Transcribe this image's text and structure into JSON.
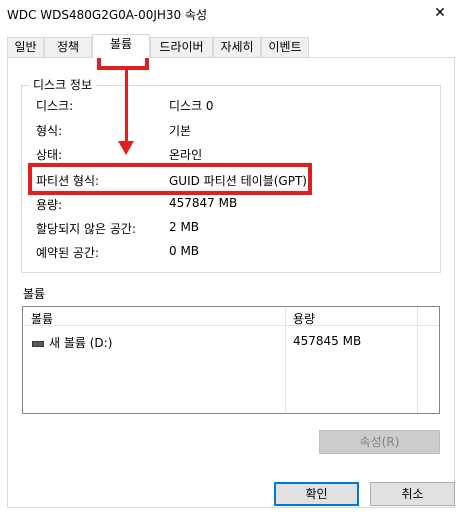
{
  "window": {
    "title": "WDC WDS480G2G0A-00JH30 속성",
    "close_glyph": "✕"
  },
  "tabs": [
    {
      "label": "일반",
      "active": false
    },
    {
      "label": "정책",
      "active": false
    },
    {
      "label": "볼륨",
      "active": true
    },
    {
      "label": "드라이버",
      "active": false
    },
    {
      "label": "자세히",
      "active": false
    },
    {
      "label": "이벤트",
      "active": false
    }
  ],
  "disk_info": {
    "title": "디스크 정보",
    "rows": [
      {
        "label": "디스크:",
        "value": "디스크 0"
      },
      {
        "label": "형식:",
        "value": "기본"
      },
      {
        "label": "상태:",
        "value": "온라인"
      },
      {
        "label": "파티션 형식:",
        "value": "GUID 파티션 테이블(GPT)"
      },
      {
        "label": "용량:",
        "value": "457847 MB"
      },
      {
        "label": "할당되지 않은 공간:",
        "value": "2 MB"
      },
      {
        "label": "예약된 공간:",
        "value": "0 MB"
      }
    ]
  },
  "volumes": {
    "caption": "볼륨",
    "columns": [
      "볼륨",
      "용량"
    ],
    "rows": [
      {
        "name": "새 볼륨 (D:)",
        "capacity": "457845 MB",
        "icon": "drive-icon"
      }
    ]
  },
  "buttons": {
    "properties": "속성(R)",
    "ok": "확인",
    "cancel": "취소"
  },
  "annotation_color": "#e02020"
}
